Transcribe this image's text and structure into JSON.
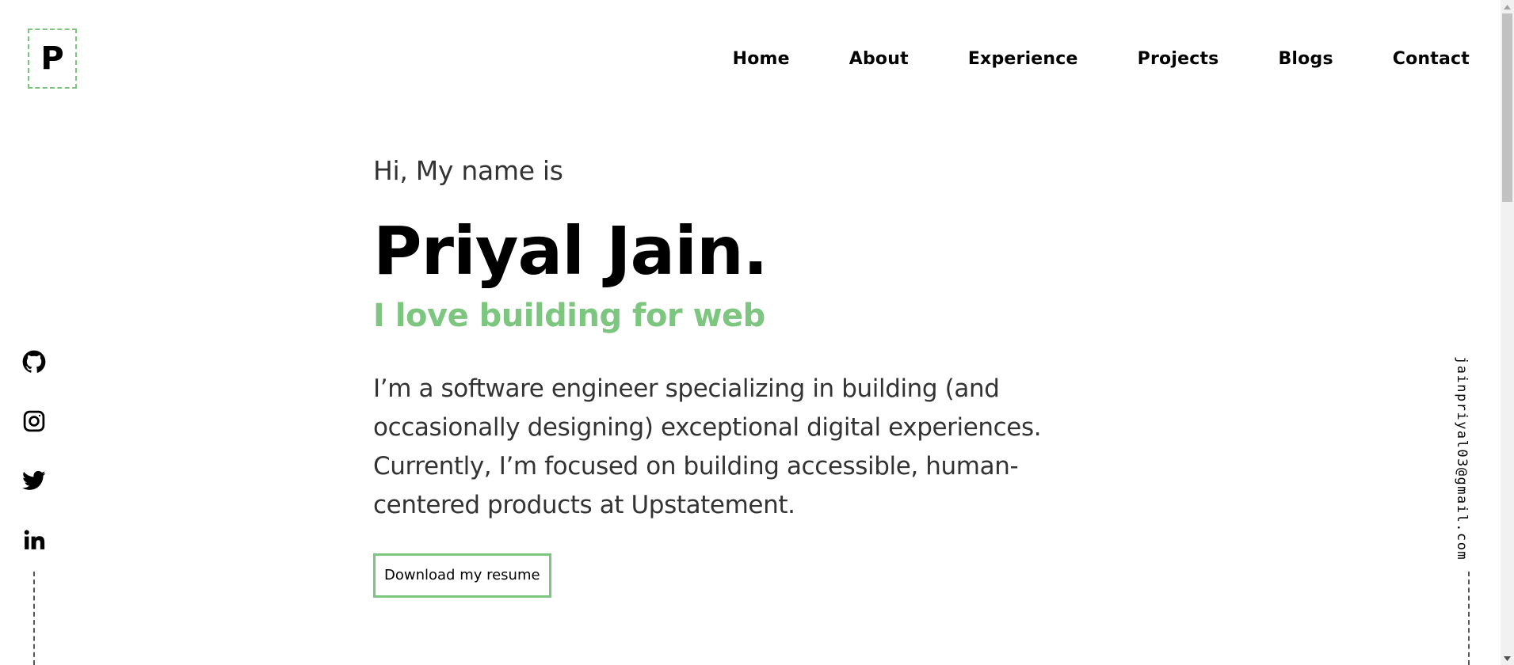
{
  "logo": {
    "letter": "P"
  },
  "nav": {
    "items": [
      {
        "label": "Home"
      },
      {
        "label": "About"
      },
      {
        "label": "Experience"
      },
      {
        "label": "Projects"
      },
      {
        "label": "Blogs"
      },
      {
        "label": "Contact"
      }
    ]
  },
  "hero": {
    "greeting": "Hi, My name is",
    "name": "Priyal Jain.",
    "tagline": "I love building for web",
    "bio": "I’m a software engineer specializing in building (and occasionally designing) exceptional digital experiences. Currently, I’m focused on building accessible, human-centered products at Upstatement.",
    "resume_button": "Download my resume"
  },
  "socials": {
    "icons": [
      "github-icon",
      "instagram-icon",
      "twitter-icon",
      "linkedin-icon"
    ]
  },
  "email": "jainpriyal03@gmail.com",
  "colors": {
    "accent": "#7cc67f",
    "text": "#333333",
    "heading": "#000000"
  }
}
